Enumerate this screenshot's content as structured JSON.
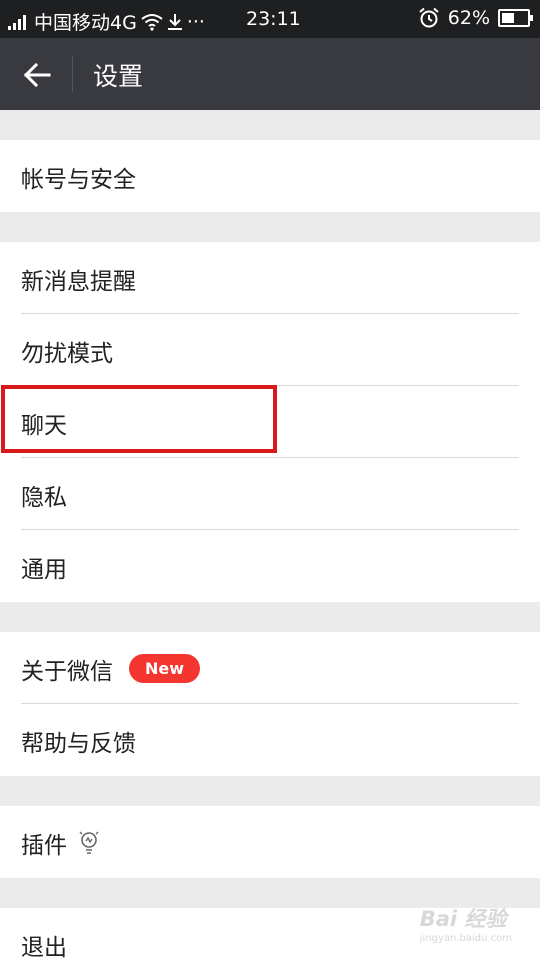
{
  "status_bar": {
    "carrier": "中国移动4G",
    "more": "···",
    "time": "23:11",
    "battery_percent": "62%",
    "battery_level": 0.62,
    "icons": [
      "signal-icon",
      "wifi-icon",
      "download-icon",
      "alarm-icon",
      "battery-icon"
    ]
  },
  "header": {
    "title": "设置"
  },
  "groups": [
    {
      "items": [
        {
          "label": "帐号与安全"
        }
      ]
    },
    {
      "items": [
        {
          "label": "新消息提醒"
        },
        {
          "label": "勿扰模式"
        },
        {
          "label": "聊天"
        },
        {
          "label": "隐私"
        },
        {
          "label": "通用"
        }
      ]
    },
    {
      "items": [
        {
          "label": "关于微信",
          "badge": "New"
        },
        {
          "label": "帮助与反馈"
        }
      ]
    },
    {
      "items": [
        {
          "label": "插件",
          "icon": "lightbulb-icon"
        }
      ]
    },
    {
      "items": [
        {
          "label": "退出"
        }
      ]
    }
  ],
  "annotation": {
    "highlighted_item": "聊天",
    "color": "#d7191c"
  },
  "watermark": {
    "text": "Bai 经验",
    "sub": "jingyan.baidu.com"
  },
  "colors": {
    "status_bar": "#1e1f21",
    "app_bar": "#393a3f",
    "badge": "#f43530",
    "background": "#ebebeb"
  }
}
